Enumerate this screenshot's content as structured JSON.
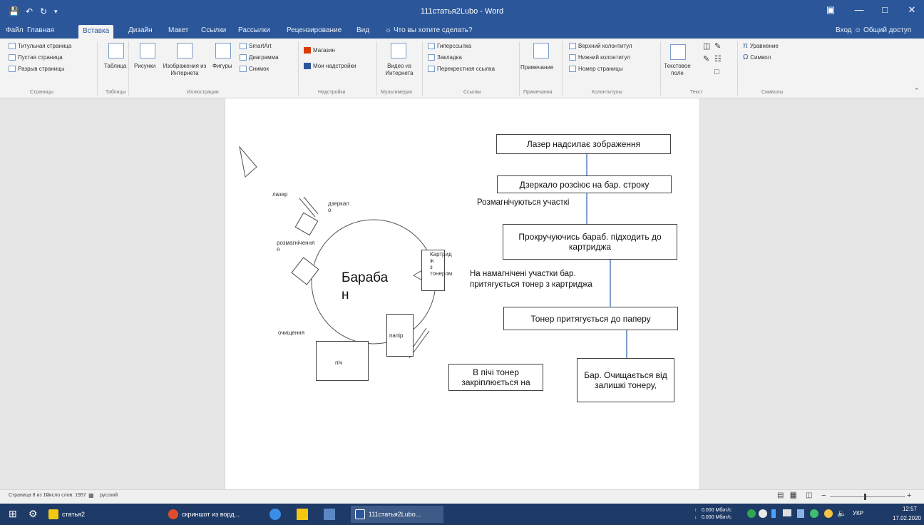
{
  "titlebar": {
    "title": "111статья2Lubo - Word"
  },
  "tabs": [
    "Файл",
    "Главная",
    "Вставка",
    "Дизайн",
    "Макет",
    "Ссылки",
    "Рассылки",
    "Рецензирование",
    "Вид"
  ],
  "tell_me": "Что вы хотите сделать?",
  "account": {
    "signin": "Вход",
    "share": "Общий доступ"
  },
  "ribbon": {
    "pages": {
      "title_page": "Титульная страница",
      "blank_page": "Пустая страница",
      "page_break": "Разрыв страницы",
      "group": "Страницы"
    },
    "tables": {
      "table": "Таблица",
      "group": "Таблицы"
    },
    "illustrations": {
      "pictures": "Рисунки",
      "online_pictures": "Изображения из Интернета",
      "shapes": "Фигуры",
      "smartart": "SmartArt",
      "chart": "Диаграмма",
      "screenshot": "Снимок",
      "group": "Иллюстрации"
    },
    "addins": {
      "store": "Магазин",
      "my_addins": "Мои надстройки",
      "group": "Надстройки"
    },
    "media": {
      "online_video": "Видео из Интернета",
      "group": "Мультимедиа"
    },
    "links": {
      "hyperlink": "Гиперссылка",
      "bookmark": "Закладка",
      "cross_ref": "Перекрестная ссылка",
      "group": "Ссылки"
    },
    "comments": {
      "comment": "Примечание",
      "group": "Примечания"
    },
    "header_footer": {
      "header": "Верхний колонтитул",
      "footer": "Нижний колонтитул",
      "page_number": "Номер страницы",
      "group": "Колонтитулы"
    },
    "text": {
      "textbox": "Текстовое поле",
      "group": "Текст"
    },
    "symbols": {
      "equation": "Уравнение",
      "symbol": "Символ",
      "group": "Символы"
    }
  },
  "diagram": {
    "labels": {
      "laser": "лазер",
      "mirror": "дзеркал\nо",
      "demagnetize": "розмагнічення\nя",
      "cleaning": "очищення",
      "paper": "папір",
      "pich": "піч",
      "cartridge": "Картрид\nж\nз\nтонером",
      "drum": "Бараба\nн"
    },
    "flow": {
      "box1": "Лазер надсилає зображення",
      "box2": "Дзеркало розсіює на бар. строку",
      "text1": "Розмагнічуються участкі",
      "box3": "Прокручуючись бараб. підходить до картриджа",
      "text2": "На намагнічені участки бар.\nпритягується тонер з картриджа",
      "box4": "Тонер притягується до паперу",
      "box5": "Бар. Очищається від\nзалишкі тонеру,",
      "box6": "В пічі тонер\nзакріплюється на"
    }
  },
  "status": {
    "page": "Страница 8 из 10",
    "words": "Число слов: 1957",
    "lang": "русский"
  },
  "taskbar": {
    "items": [
      "статья2",
      "скриншот из ворд...",
      "111статья2Lubo..."
    ],
    "tray": {
      "net1": "0.000 Мбит/с",
      "net2": "0.000 Мбит/с",
      "lang": "УКР",
      "time": "12:57",
      "date": "17.02.2020"
    }
  },
  "colors": {
    "accent": "#2b579a",
    "taskbar": "#1e3a66"
  }
}
